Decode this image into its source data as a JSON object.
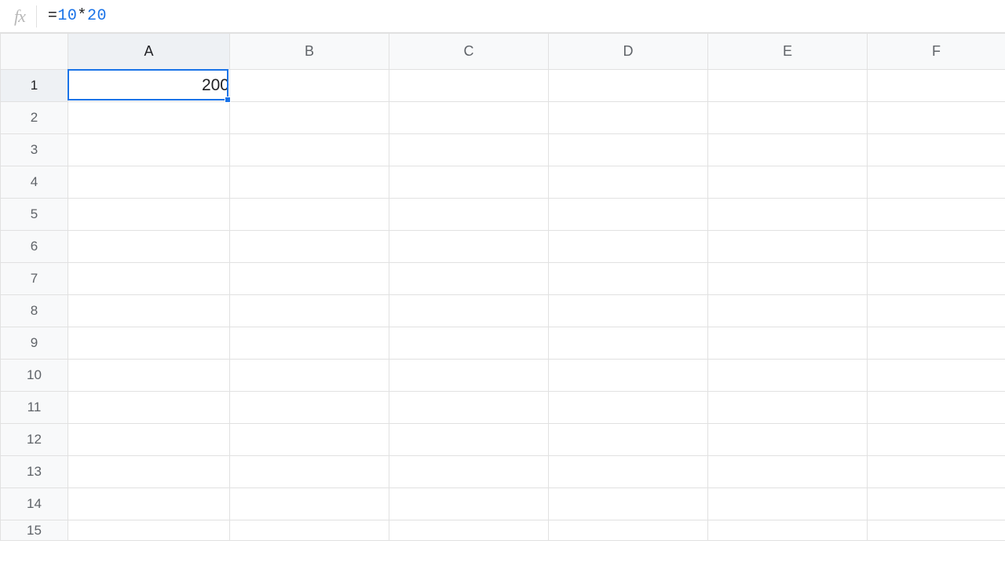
{
  "formula_bar": {
    "fx_label": "fx",
    "formula_display": "=10*20",
    "formula_parts": {
      "eq": "=",
      "n1": "10",
      "op": "*",
      "n2": "20"
    }
  },
  "columns": [
    "A",
    "B",
    "C",
    "D",
    "E",
    "F"
  ],
  "row_numbers": [
    "1",
    "2",
    "3",
    "4",
    "5",
    "6",
    "7",
    "8",
    "9",
    "10",
    "11",
    "12",
    "13",
    "14",
    "15"
  ],
  "selected_cell": {
    "ref": "A1",
    "value": "200"
  },
  "cells": {
    "A1": "200"
  },
  "colors": {
    "selection": "#1a73e8",
    "header_bg": "#f8f9fa",
    "grid_line": "#e1e1e1"
  }
}
